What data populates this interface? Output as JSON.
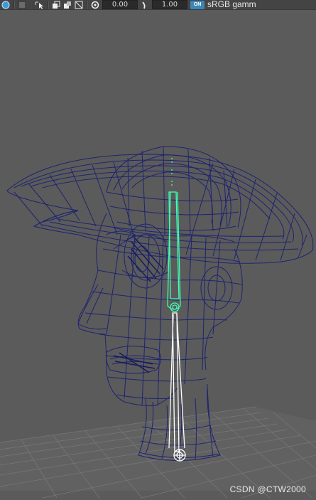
{
  "toolbar": {
    "field_a_value": "0.00",
    "field_b_value": "1.00",
    "on_badge": "ON",
    "color_space": "sRGB gamm"
  },
  "icons": [
    "camera-icon",
    "grid-icon",
    "select-arrow-icon",
    "isolate-icon",
    "xray-icon",
    "wireframe-icon",
    "aperture-icon",
    "gamma-icon",
    "color-management-icon"
  ],
  "viewport": {
    "background": "#5b5b5b",
    "wire_color": "#1e2470",
    "joint_color": "#3dffb4",
    "selected_joint_color": "#ffffff",
    "grid_color": "#7a7a7a"
  },
  "watermark": "CSDN @CTW2000"
}
